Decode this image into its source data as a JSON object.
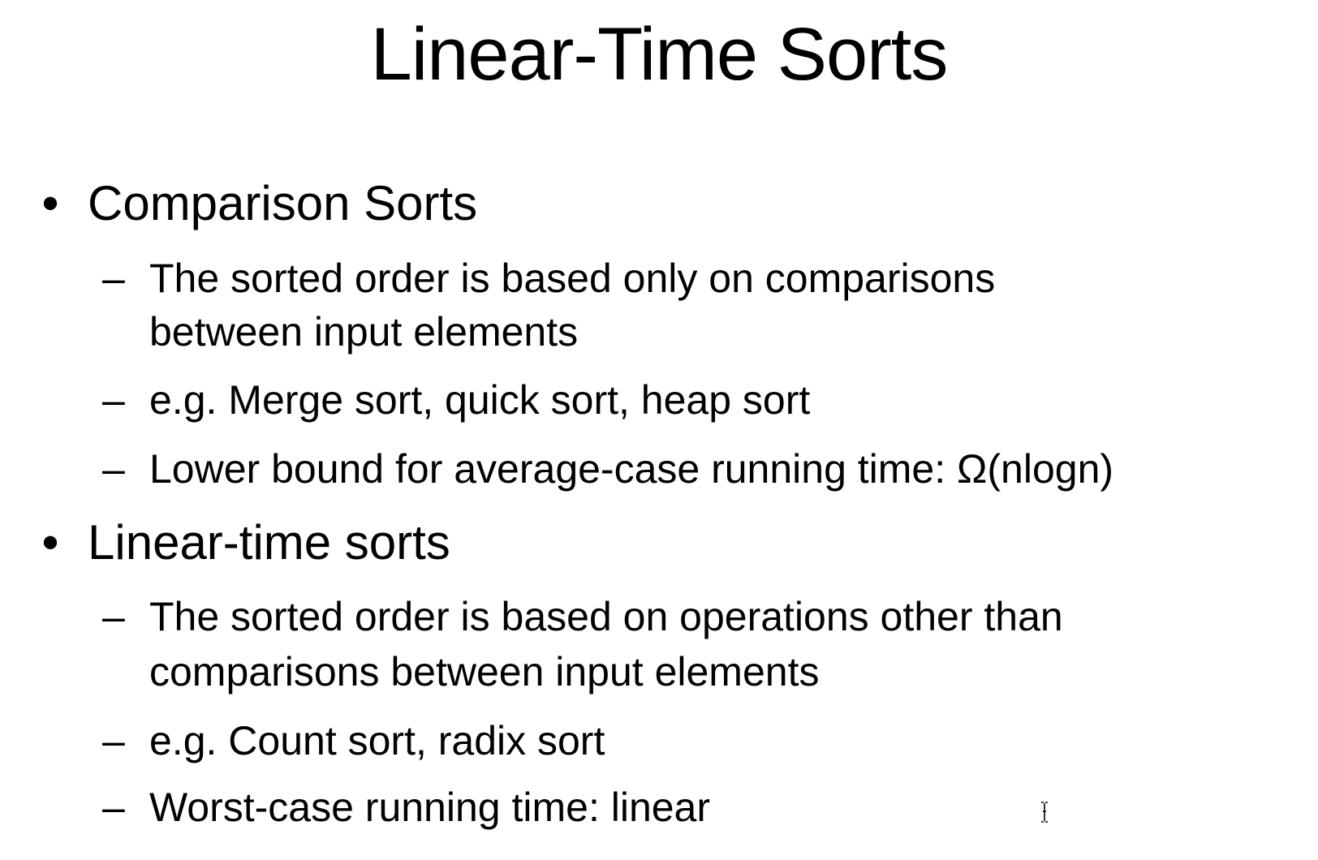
{
  "slide": {
    "title": "Linear-Time Sorts",
    "bullet_symbol": "•",
    "dash_symbol": "–",
    "sections": [
      {
        "heading": "Comparison Sorts",
        "items": [
          [
            "The sorted order is based only on comparisons",
            "between input elements"
          ],
          [
            "e.g. Merge sort, quick sort, heap sort"
          ],
          [
            "Lower bound for average-case running time: Ω(nlogn)"
          ]
        ]
      },
      {
        "heading": "Linear-time sorts",
        "items": [
          [
            "The sorted order is based on operations other than",
            "comparisons between input elements"
          ],
          [
            "e.g. Count sort, radix sort"
          ],
          [
            "Worst-case running time: linear"
          ]
        ]
      }
    ]
  },
  "cursor_icon": "text-cursor-icon"
}
